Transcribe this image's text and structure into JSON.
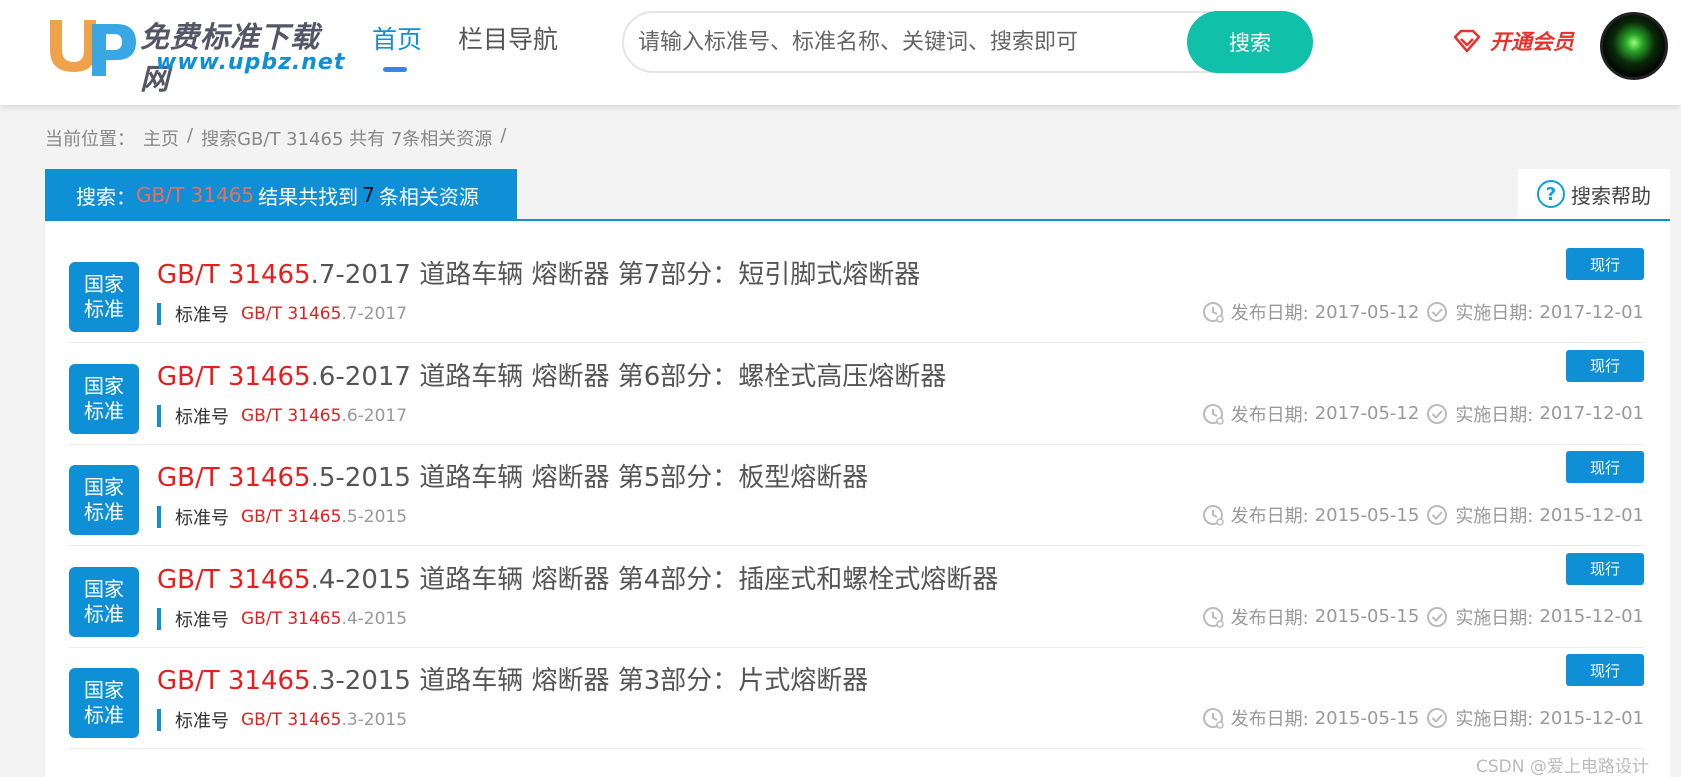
{
  "header": {
    "logo_cn": "免费标准下载网",
    "logo_url": "www.upbz.net",
    "nav_home": "首页",
    "nav_columns": "栏目导航",
    "search_placeholder": "请输入标准号、标准名称、关键词、搜索即可",
    "search_button": "搜索",
    "vip_label": "开通会员"
  },
  "breadcrumb": {
    "prefix": "当前位置：",
    "home": "主页",
    "sep1": "/",
    "current": "搜索GB/T 31465 共有 7条相关资源",
    "sep2": "/"
  },
  "result_bar": {
    "prefix": "搜索：",
    "keyword": "GB/T 31465",
    "middle": "结果共找到",
    "count": "7",
    "suffix": "条相关资源",
    "help_label": "搜索帮助"
  },
  "labels": {
    "badge_line1": "国家",
    "badge_line2": "标准",
    "code_label": "标准号",
    "status": "现行",
    "publish_prefix": "发布日期:",
    "effective_prefix": "实施日期:"
  },
  "results": [
    {
      "hl": "GB/T 31465",
      "title_rest": ".7-2017 道路车辆 熔断器 第7部分：短引脚式熔断器",
      "code_rest": ".7-2017",
      "publish": "2017-05-12",
      "effective": "2017-12-01"
    },
    {
      "hl": "GB/T 31465",
      "title_rest": ".6-2017 道路车辆 熔断器 第6部分：螺栓式高压熔断器",
      "code_rest": ".6-2017",
      "publish": "2017-05-12",
      "effective": "2017-12-01"
    },
    {
      "hl": "GB/T 31465",
      "title_rest": ".5-2015 道路车辆 熔断器 第5部分：板型熔断器",
      "code_rest": ".5-2015",
      "publish": "2015-05-15",
      "effective": "2015-12-01"
    },
    {
      "hl": "GB/T 31465",
      "title_rest": ".4-2015 道路车辆 熔断器 第4部分：插座式和螺栓式熔断器",
      "code_rest": ".4-2015",
      "publish": "2015-05-15",
      "effective": "2015-12-01"
    },
    {
      "hl": "GB/T 31465",
      "title_rest": ".3-2015 道路车辆 熔断器 第3部分：片式熔断器",
      "code_rest": ".3-2015",
      "publish": "2015-05-15",
      "effective": "2015-12-01"
    }
  ],
  "watermark": "CSDN @爱上电路设计",
  "colors": {
    "primary": "#0e8fd6",
    "accent_green": "#10c0a8",
    "highlight_red": "#e81e1e",
    "vip_red": "#e8322d"
  }
}
